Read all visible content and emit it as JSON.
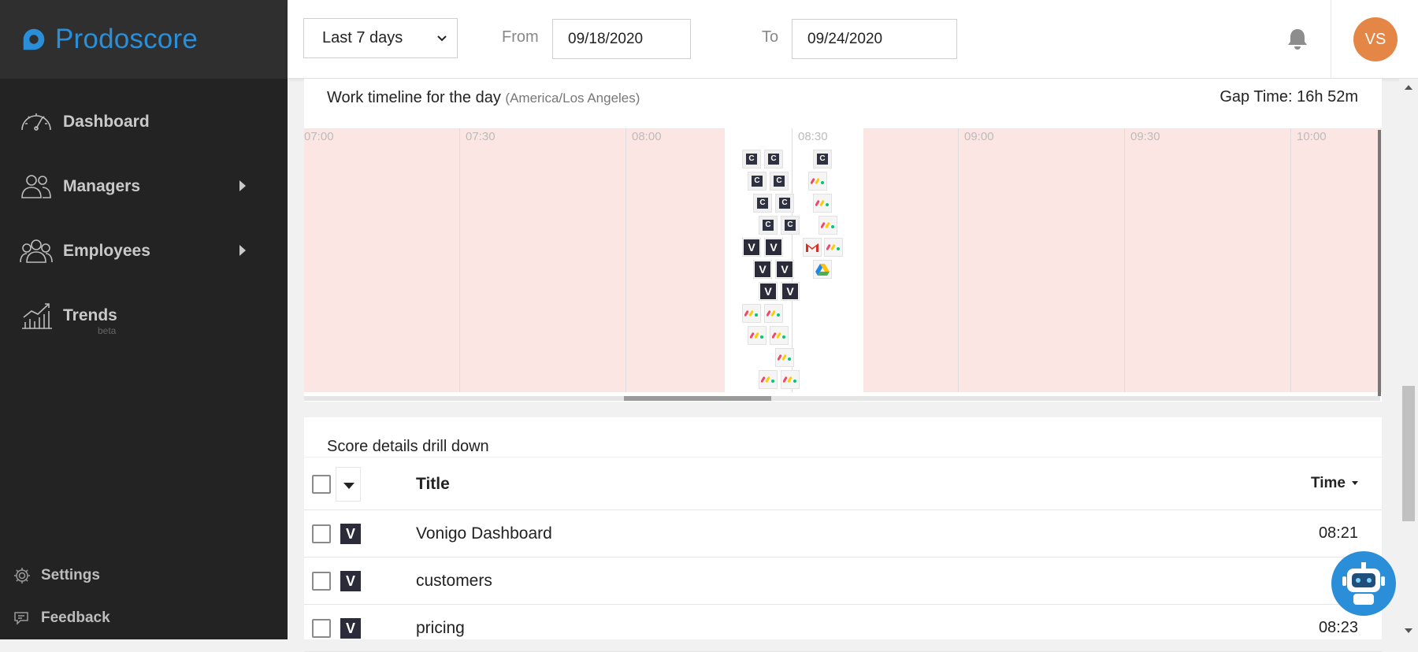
{
  "brand": {
    "name": "Prodoscore"
  },
  "sidebar": {
    "items": [
      {
        "label": "Dashboard",
        "icon": "speedometer-icon"
      },
      {
        "label": "Managers",
        "icon": "managers-icon"
      },
      {
        "label": "Employees",
        "icon": "employees-icon"
      },
      {
        "label": "Trends",
        "icon": "trends-icon",
        "badge": "beta"
      }
    ],
    "bottom": [
      {
        "label": "Settings",
        "icon": "gear-icon"
      },
      {
        "label": "Feedback",
        "icon": "feedback-icon"
      }
    ]
  },
  "topbar": {
    "range": "Last 7 days",
    "from_label": "From",
    "from_value": "09/18/2020",
    "to_label": "To",
    "to_value": "09/24/2020",
    "avatar_initials": "VS"
  },
  "timeline": {
    "title": "Work timeline for the day",
    "timezone": "(America/Los Angeles)",
    "gap_time": "Gap Time: 16h 52m",
    "ticks": [
      "07:00",
      "07:30",
      "08:00",
      "08:30",
      "09:00",
      "09:30",
      "10:00"
    ]
  },
  "drill": {
    "title": "Score details drill down",
    "col_title": "Title",
    "col_time": "Time",
    "rows": [
      {
        "badge": "V",
        "title": "Vonigo Dashboard",
        "time": "08:21"
      },
      {
        "badge": "V",
        "title": "customers",
        "time": "08"
      },
      {
        "badge": "V",
        "title": "pricing",
        "time": "08:23"
      }
    ]
  },
  "colors": {
    "accent": "#2a8fd8",
    "sidebar": "#232323",
    "gap_block": "#fce6e3",
    "avatar": "#e48646"
  }
}
